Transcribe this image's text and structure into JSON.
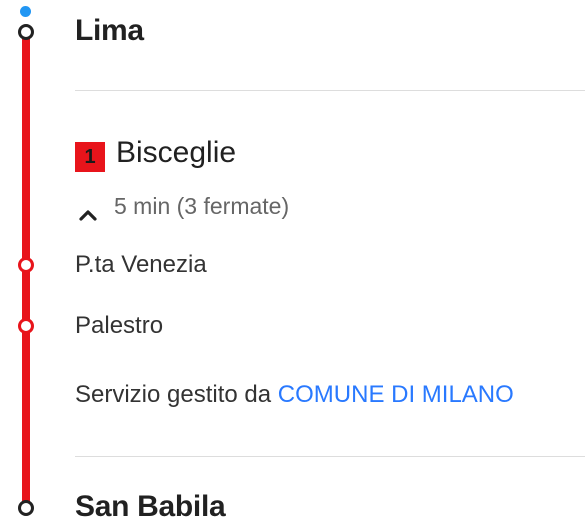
{
  "itinerary": {
    "origin_stop": "Lima",
    "line": {
      "number": "1",
      "color": "#e8141b"
    },
    "direction": "Bisceglie",
    "trip_info": "5 min (3 fermate)",
    "intermediate_stops": [
      "P.ta Venezia",
      "Palestro"
    ],
    "operator": {
      "prefix": "Servizio gestito da ",
      "link": "COMUNE DI MILANO"
    },
    "destination_stop": "San Babila"
  },
  "icons": {
    "collapse": "chevron-up-icon",
    "current_location": "location-dot-icon",
    "stop_marker": "circle-icon"
  }
}
